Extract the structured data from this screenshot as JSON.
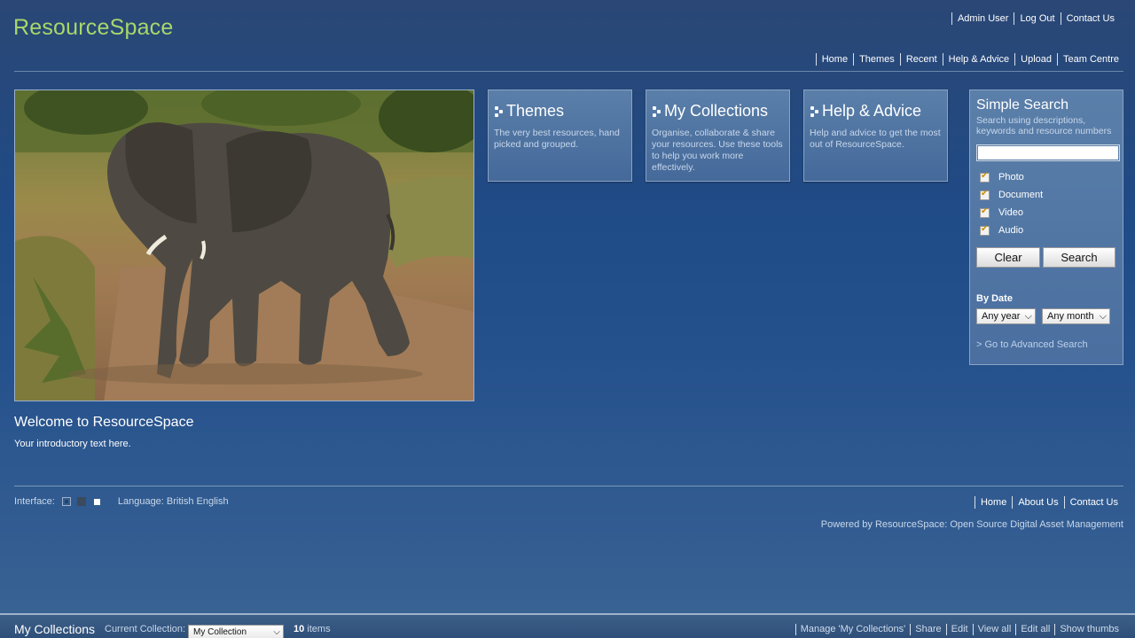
{
  "app": {
    "logo": "ResourceSpace"
  },
  "toplinks": [
    "Admin User",
    "Log Out",
    "Contact Us"
  ],
  "nav": [
    "Home",
    "Themes",
    "Recent",
    "Help & Advice",
    "Upload",
    "Team Centre"
  ],
  "welcome": {
    "title": "Welcome to ResourceSpace",
    "text": "Your introductory text here."
  },
  "panels": [
    {
      "title": "Themes",
      "desc": "The very best resources, hand picked and grouped."
    },
    {
      "title": "My Collections",
      "desc": "Organise, collaborate & share your resources. Use these tools to help you work more effectively."
    },
    {
      "title": "Help & Advice",
      "desc": "Help and advice to get the most out of ResourceSpace."
    }
  ],
  "search": {
    "title": "Simple Search",
    "desc": "Search using descriptions, keywords and resource numbers",
    "input_value": "",
    "types": [
      "Photo",
      "Document",
      "Video",
      "Audio"
    ],
    "clear_label": "Clear",
    "search_label": "Search",
    "by_date": "By Date",
    "year_value": "Any year",
    "month_value": "Any month",
    "advanced_link": "> Go to Advanced Search"
  },
  "footer": {
    "interface_label": "Interface:",
    "language": "Language: British English",
    "links": [
      "Home",
      "About Us",
      "Contact Us"
    ],
    "powered": "Powered by ResourceSpace: Open Source Digital Asset Management"
  },
  "collections_bar": {
    "title": "My Collections",
    "current_label": "Current Collection:",
    "current_value": "My Collection",
    "count": "10",
    "count_suffix": " items",
    "links": [
      "Manage 'My Collections'",
      "Share",
      "Edit",
      "View all",
      "Edit all",
      "Show thumbs"
    ]
  },
  "icons": {
    "dropdown": "chevron-down-icon",
    "check": "checkmark-icon",
    "bullet": "dots-icon"
  }
}
